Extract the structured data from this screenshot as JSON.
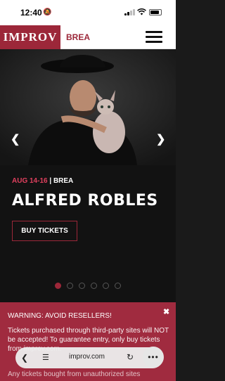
{
  "status_bar": {
    "time": "12:40"
  },
  "header": {
    "logo": "IMPROV",
    "location": "BREA"
  },
  "event": {
    "date": "AUG 14-16",
    "separator": " | ",
    "venue": "BREA",
    "headliner": "ALFRED ROBLES",
    "cta_label": "BUY TICKETS"
  },
  "carousel": {
    "slide_count": 6,
    "active_index": 0
  },
  "warning": {
    "title": "WARNING: AVOID RESELLERS!",
    "body": "Tickets purchased through third-party sites will NOT be accepted! To guarantee entry, only buy tickets from improv.com.",
    "body_more": "Any tickets bought from unauthorized sites",
    "close_glyph": "✖"
  },
  "browser": {
    "url": "improv.com"
  },
  "colors": {
    "brand": "#9c2739",
    "date_accent": "#e0405e"
  }
}
